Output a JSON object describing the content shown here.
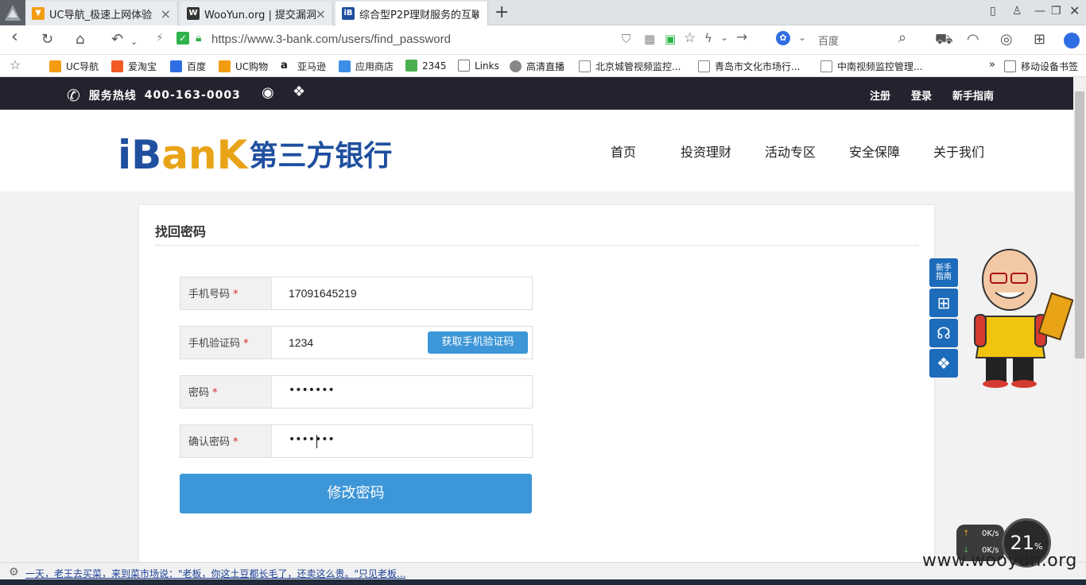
{
  "browser": {
    "tabs": [
      {
        "title": "UC导航_极速上网体验",
        "active": false
      },
      {
        "title": "WooYun.org | 提交漏洞",
        "active": false
      },
      {
        "title": "综合型P2P理财服务的互联",
        "active": true
      }
    ],
    "url": "https://www.3-bank.com/users/find_password",
    "search_placeholder": "百度",
    "bookmarks": [
      "UC导航",
      "爱淘宝",
      "百度",
      "UC购物",
      "亚马逊",
      "应用商店",
      "2345",
      "Links",
      "高清直播",
      "北京城管视频监控...",
      "青岛市文化市场行...",
      "中南视频监控管理..."
    ],
    "bookmarks_overflow": "»",
    "mobile_bookmarks": "移动设备书签"
  },
  "site": {
    "hotline_label": "服务热线",
    "hotline_number": "400-163-0003",
    "top_links": [
      "注册",
      "登录",
      "新手指南"
    ],
    "logo_i": "i",
    "logo_b": "B",
    "logo_ank": "anK",
    "logo_cn": "第三方银行",
    "nav": [
      "首页",
      "投资理财",
      "活动专区",
      "安全保障",
      "关于我们"
    ]
  },
  "form": {
    "title": "找回密码",
    "required_mark": "*",
    "phone_label": "手机号码",
    "phone_value": "17091645219",
    "code_label": "手机验证码",
    "code_value": "1234",
    "get_code_button": "获取手机验证码",
    "password_label": "密码",
    "password_value": "•••••••",
    "confirm_label": "确认密码",
    "confirm_value": "•••••••",
    "submit_button": "修改密码"
  },
  "sidebar": {
    "guide_label": "新手\n指南"
  },
  "status": {
    "news_text": "一天，老王去买菜，来到菜市场说：\"老板，你这土豆都长毛了，还卖这么贵。\"只见老板...",
    "upload_speed": "0K/s",
    "download_speed": "0K/s",
    "boost_percent": "21",
    "boost_unit": "%",
    "watermark": "www.wooyun.org"
  }
}
